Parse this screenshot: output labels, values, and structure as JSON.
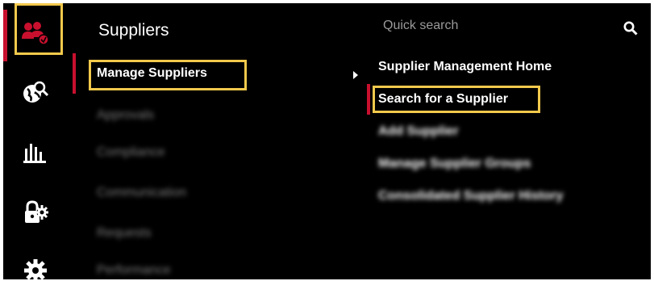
{
  "theme": {
    "accent": "#c8102e",
    "highlight": "#f2c94c",
    "background": "#000000"
  },
  "rail": {
    "items": [
      {
        "icon": "suppliers-group-icon",
        "active": true
      },
      {
        "icon": "globe-search-icon",
        "active": false
      },
      {
        "icon": "bar-chart-icon",
        "active": false
      },
      {
        "icon": "lock-gear-icon",
        "active": false
      },
      {
        "icon": "gear-icon",
        "active": false
      }
    ]
  },
  "column2": {
    "title": "Suppliers",
    "items": [
      {
        "label": "Manage Suppliers",
        "selected": true
      },
      {
        "label": "Approvals",
        "blurred": true
      },
      {
        "label": "Compliance",
        "blurred": true
      },
      {
        "label": "Communication",
        "blurred": true
      },
      {
        "label": "Requests",
        "blurred": true
      },
      {
        "label": "Performance",
        "blurred": true
      }
    ]
  },
  "column3": {
    "search": {
      "placeholder": "Quick search",
      "icon": "search-icon"
    },
    "items": [
      {
        "label": "Supplier Management Home"
      },
      {
        "label": "Search for a Supplier",
        "highlighted": true
      },
      {
        "label": "Add Supplier",
        "blurred": true
      },
      {
        "label": "Manage Supplier Groups",
        "blurred": true
      },
      {
        "label": "Consolidated Supplier History",
        "blurred": true
      }
    ]
  }
}
